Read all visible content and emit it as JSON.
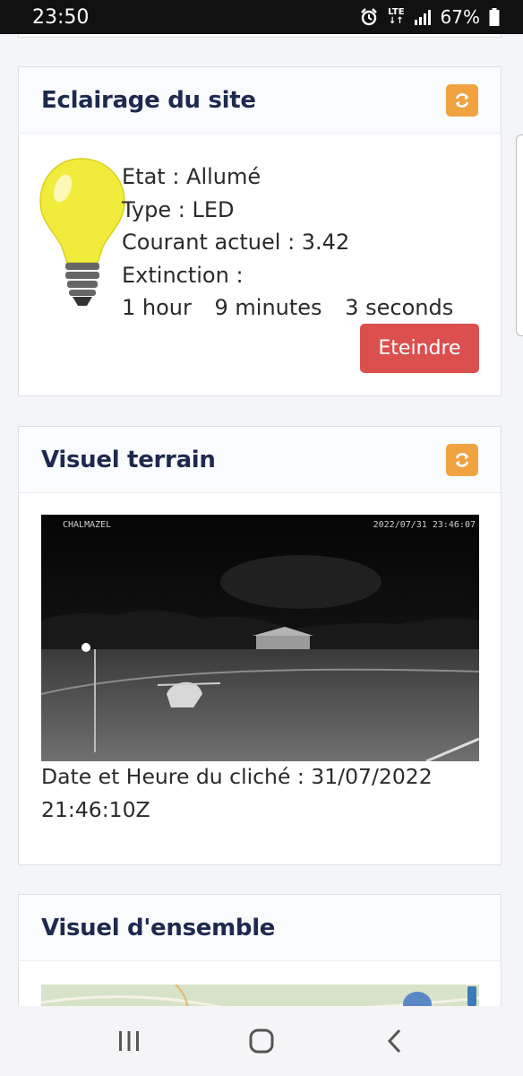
{
  "status_bar": {
    "time": "23:50",
    "network": "LTE",
    "battery": "67%",
    "icons": [
      "alarm-icon",
      "lte-icon",
      "signal-icon",
      "battery-icon"
    ]
  },
  "eclairage": {
    "title": "Eclairage du site",
    "refresh_icon": "refresh-icon",
    "etat": "Etat : Allumé",
    "type": "Type : LED",
    "courant": "Courant actuel : 3.42",
    "extinction": "Extinction :",
    "hours": "1 hour",
    "minutes": "9 minutes",
    "seconds": "3 seconds",
    "button_label": "Eteindre",
    "button_color": "#db4f4f",
    "bulb_icon": "light-bulb-icon"
  },
  "visuel_terrain": {
    "title": "Visuel terrain",
    "refresh_icon": "refresh-icon",
    "camera_name": "CHALMAZEL",
    "camera_timestamp": "2022/07/31 23:46:07",
    "caption_line1": "Date et Heure du cliché : 31/07/2022",
    "caption_line2": "21:46:10Z"
  },
  "visuel_ensemble": {
    "title": "Visuel d'ensemble"
  },
  "colors": {
    "accent": "#f0a340",
    "title": "#1d2a4f",
    "danger": "#db4f4f"
  },
  "nav_bar": {
    "icons": [
      "recent-apps-icon",
      "home-icon",
      "back-icon"
    ]
  }
}
